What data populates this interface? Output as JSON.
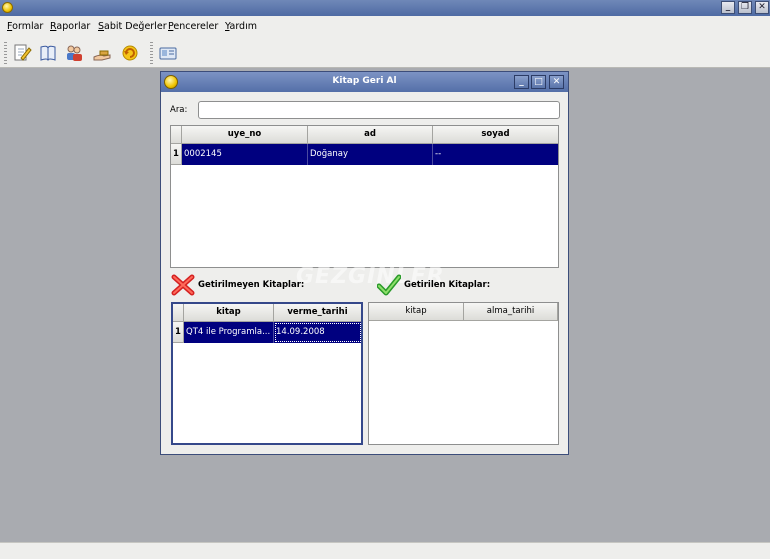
{
  "menubar": {
    "items": [
      {
        "label": "Formlar",
        "accel": "F",
        "rest": "ormlar"
      },
      {
        "label": "Raporlar",
        "accel": "R",
        "rest": "aporlar"
      },
      {
        "label": "Sabit Değerler",
        "accel": "S",
        "rest": "abit Değerler"
      },
      {
        "label": "Pencereler",
        "accel": "P",
        "rest": "encereler"
      },
      {
        "label": "Yardım",
        "accel": "Y",
        "rest": "ardım"
      }
    ]
  },
  "toolbar": {
    "icons": [
      "edit-document-icon",
      "book-icon",
      "users-icon",
      "hand-give-icon",
      "return-arrow-icon",
      "id-card-icon"
    ]
  },
  "window_controls": {
    "minimize": "_",
    "restore": "❐",
    "close": "✕"
  },
  "dialog": {
    "title": "Kitap Geri Al",
    "controls": {
      "minimize": "_",
      "maximize": "□",
      "close": "✕"
    },
    "search": {
      "label": "Ara:",
      "value": ""
    },
    "members_table": {
      "columns": [
        "uye_no",
        "ad",
        "soyad"
      ],
      "rows": [
        {
          "num": "1",
          "cells": [
            "0002145",
            "Doğanay",
            "--"
          ]
        }
      ]
    },
    "not_returned": {
      "label": "Getirilmeyen Kitaplar:",
      "columns": [
        "kitap",
        "verme_tarihi"
      ],
      "rows": [
        {
          "num": "1",
          "cells": [
            "QT4 ile Programla...",
            "14.09.2008"
          ]
        }
      ]
    },
    "returned": {
      "label": "Getirilen Kitaplar:",
      "columns": [
        "kitap",
        "alma_tarihi"
      ],
      "rows": []
    },
    "watermark": "GEZGİNLER"
  },
  "colors": {
    "selection": "#00007f",
    "title_bar": "#546fa8",
    "background": "#a9abb0"
  }
}
